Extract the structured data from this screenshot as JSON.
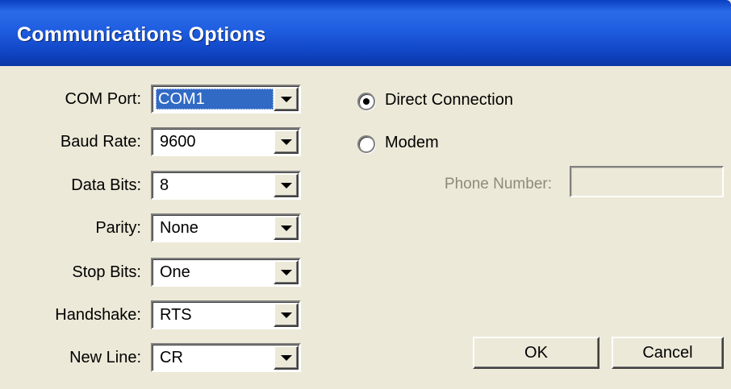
{
  "window": {
    "title": "Communications Options"
  },
  "settings": [
    {
      "label": "COM Port:",
      "value": "COM1"
    },
    {
      "label": "Baud Rate:",
      "value": "9600"
    },
    {
      "label": "Data Bits:",
      "value": "8"
    },
    {
      "label": "Parity:",
      "value": "None"
    },
    {
      "label": "Stop Bits:",
      "value": "One"
    },
    {
      "label": "Handshake:",
      "value": "RTS"
    },
    {
      "label": "New Line:",
      "value": "CR"
    }
  ],
  "connection": {
    "direct_label": "Direct Connection",
    "direct_selected": true,
    "modem_label": "Modem",
    "modem_selected": false,
    "phone_label": "Phone Number:",
    "phone_value": "",
    "phone_enabled": false
  },
  "buttons": {
    "ok_label": "OK",
    "cancel_label": "Cancel"
  },
  "colors": {
    "titlebar": "#1f5ee0",
    "dialog_background": "#ece9d8",
    "selection": "#316ac5",
    "disabled_text": "#8c8a7a"
  },
  "icons": {
    "dropdown": "chevron-down-icon",
    "radio": "radio-icon"
  }
}
